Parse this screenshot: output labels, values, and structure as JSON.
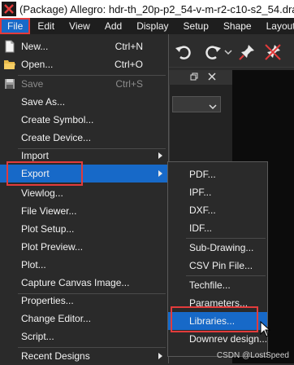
{
  "window": {
    "title": "(Package) Allegro: hdr-th_20p-p2_54-v-m-r2-c10-s2_54.dra"
  },
  "menubar": {
    "items": [
      "File",
      "Edit",
      "View",
      "Add",
      "Display",
      "Setup",
      "Shape",
      "Layout"
    ]
  },
  "file_menu": {
    "new": {
      "label": "New...",
      "shortcut": "Ctrl+N",
      "icon": "new-file-icon"
    },
    "open": {
      "label": "Open...",
      "shortcut": "Ctrl+O",
      "icon": "open-folder-icon"
    },
    "save": {
      "label": "Save",
      "shortcut": "Ctrl+S",
      "icon": "save-icon"
    },
    "save_as": "Save As...",
    "create_symbol": "Create Symbol...",
    "create_device": "Create Device...",
    "import": "Import",
    "export": "Export",
    "viewlog": "Viewlog...",
    "file_viewer": "File Viewer...",
    "plot_setup": "Plot Setup...",
    "plot_preview": "Plot Preview...",
    "plot": "Plot...",
    "capture_canvas": "Capture Canvas Image...",
    "properties": "Properties...",
    "change_editor": "Change Editor...",
    "script": "Script...",
    "recent_designs": "Recent Designs"
  },
  "export_submenu": {
    "items": [
      "PDF...",
      "IPF...",
      "DXF...",
      "IDF...",
      "Sub-Drawing...",
      "CSV Pin File...",
      "Techfile...",
      "Parameters...",
      "Libraries...",
      "Downrev design..."
    ]
  },
  "watermark": "CSDN @LostSpeed",
  "colors": {
    "highlight": "#1769c8",
    "annotation": "#e23b3b",
    "menu_bg": "#2a2a2a"
  }
}
